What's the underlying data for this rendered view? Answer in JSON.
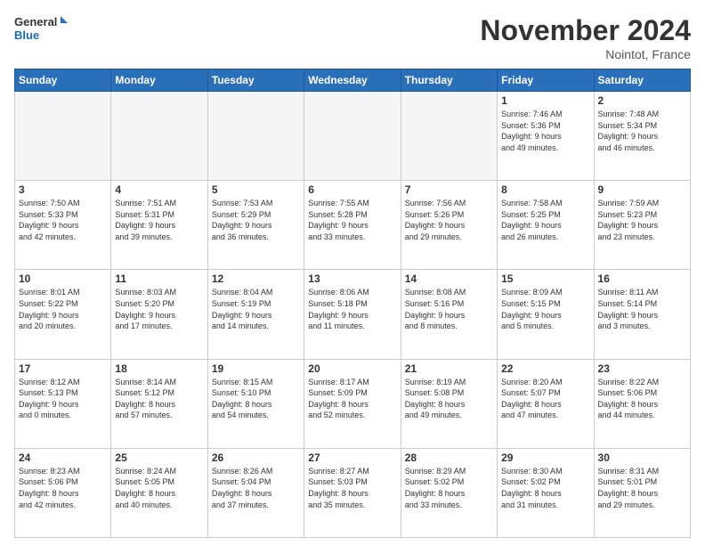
{
  "logo": {
    "line1": "General",
    "line2": "Blue"
  },
  "header": {
    "title": "November 2024",
    "location": "Nointot, France"
  },
  "weekdays": [
    "Sunday",
    "Monday",
    "Tuesday",
    "Wednesday",
    "Thursday",
    "Friday",
    "Saturday"
  ],
  "weeks": [
    [
      {
        "day": "",
        "info": ""
      },
      {
        "day": "",
        "info": ""
      },
      {
        "day": "",
        "info": ""
      },
      {
        "day": "",
        "info": ""
      },
      {
        "day": "",
        "info": ""
      },
      {
        "day": "1",
        "info": "Sunrise: 7:46 AM\nSunset: 5:36 PM\nDaylight: 9 hours\nand 49 minutes."
      },
      {
        "day": "2",
        "info": "Sunrise: 7:48 AM\nSunset: 5:34 PM\nDaylight: 9 hours\nand 46 minutes."
      }
    ],
    [
      {
        "day": "3",
        "info": "Sunrise: 7:50 AM\nSunset: 5:33 PM\nDaylight: 9 hours\nand 42 minutes."
      },
      {
        "day": "4",
        "info": "Sunrise: 7:51 AM\nSunset: 5:31 PM\nDaylight: 9 hours\nand 39 minutes."
      },
      {
        "day": "5",
        "info": "Sunrise: 7:53 AM\nSunset: 5:29 PM\nDaylight: 9 hours\nand 36 minutes."
      },
      {
        "day": "6",
        "info": "Sunrise: 7:55 AM\nSunset: 5:28 PM\nDaylight: 9 hours\nand 33 minutes."
      },
      {
        "day": "7",
        "info": "Sunrise: 7:56 AM\nSunset: 5:26 PM\nDaylight: 9 hours\nand 29 minutes."
      },
      {
        "day": "8",
        "info": "Sunrise: 7:58 AM\nSunset: 5:25 PM\nDaylight: 9 hours\nand 26 minutes."
      },
      {
        "day": "9",
        "info": "Sunrise: 7:59 AM\nSunset: 5:23 PM\nDaylight: 9 hours\nand 23 minutes."
      }
    ],
    [
      {
        "day": "10",
        "info": "Sunrise: 8:01 AM\nSunset: 5:22 PM\nDaylight: 9 hours\nand 20 minutes."
      },
      {
        "day": "11",
        "info": "Sunrise: 8:03 AM\nSunset: 5:20 PM\nDaylight: 9 hours\nand 17 minutes."
      },
      {
        "day": "12",
        "info": "Sunrise: 8:04 AM\nSunset: 5:19 PM\nDaylight: 9 hours\nand 14 minutes."
      },
      {
        "day": "13",
        "info": "Sunrise: 8:06 AM\nSunset: 5:18 PM\nDaylight: 9 hours\nand 11 minutes."
      },
      {
        "day": "14",
        "info": "Sunrise: 8:08 AM\nSunset: 5:16 PM\nDaylight: 9 hours\nand 8 minutes."
      },
      {
        "day": "15",
        "info": "Sunrise: 8:09 AM\nSunset: 5:15 PM\nDaylight: 9 hours\nand 5 minutes."
      },
      {
        "day": "16",
        "info": "Sunrise: 8:11 AM\nSunset: 5:14 PM\nDaylight: 9 hours\nand 3 minutes."
      }
    ],
    [
      {
        "day": "17",
        "info": "Sunrise: 8:12 AM\nSunset: 5:13 PM\nDaylight: 9 hours\nand 0 minutes."
      },
      {
        "day": "18",
        "info": "Sunrise: 8:14 AM\nSunset: 5:12 PM\nDaylight: 8 hours\nand 57 minutes."
      },
      {
        "day": "19",
        "info": "Sunrise: 8:15 AM\nSunset: 5:10 PM\nDaylight: 8 hours\nand 54 minutes."
      },
      {
        "day": "20",
        "info": "Sunrise: 8:17 AM\nSunset: 5:09 PM\nDaylight: 8 hours\nand 52 minutes."
      },
      {
        "day": "21",
        "info": "Sunrise: 8:19 AM\nSunset: 5:08 PM\nDaylight: 8 hours\nand 49 minutes."
      },
      {
        "day": "22",
        "info": "Sunrise: 8:20 AM\nSunset: 5:07 PM\nDaylight: 8 hours\nand 47 minutes."
      },
      {
        "day": "23",
        "info": "Sunrise: 8:22 AM\nSunset: 5:06 PM\nDaylight: 8 hours\nand 44 minutes."
      }
    ],
    [
      {
        "day": "24",
        "info": "Sunrise: 8:23 AM\nSunset: 5:06 PM\nDaylight: 8 hours\nand 42 minutes."
      },
      {
        "day": "25",
        "info": "Sunrise: 8:24 AM\nSunset: 5:05 PM\nDaylight: 8 hours\nand 40 minutes."
      },
      {
        "day": "26",
        "info": "Sunrise: 8:26 AM\nSunset: 5:04 PM\nDaylight: 8 hours\nand 37 minutes."
      },
      {
        "day": "27",
        "info": "Sunrise: 8:27 AM\nSunset: 5:03 PM\nDaylight: 8 hours\nand 35 minutes."
      },
      {
        "day": "28",
        "info": "Sunrise: 8:29 AM\nSunset: 5:02 PM\nDaylight: 8 hours\nand 33 minutes."
      },
      {
        "day": "29",
        "info": "Sunrise: 8:30 AM\nSunset: 5:02 PM\nDaylight: 8 hours\nand 31 minutes."
      },
      {
        "day": "30",
        "info": "Sunrise: 8:31 AM\nSunset: 5:01 PM\nDaylight: 8 hours\nand 29 minutes."
      }
    ]
  ]
}
